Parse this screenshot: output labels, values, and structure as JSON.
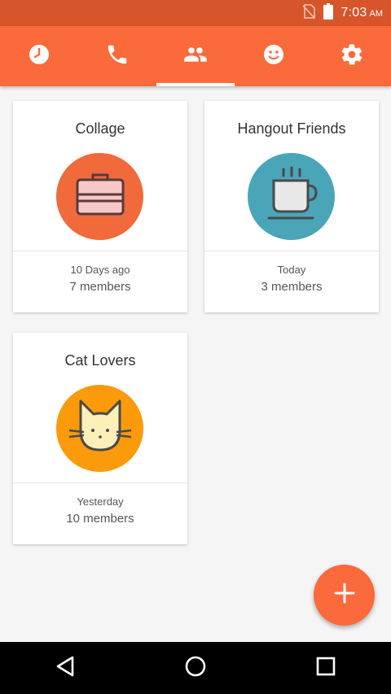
{
  "status_bar": {
    "time": "7:03",
    "ampm": "AM"
  },
  "tabs": [
    {
      "name": "recent",
      "icon": "clock-icon"
    },
    {
      "name": "calls",
      "icon": "phone-icon"
    },
    {
      "name": "groups",
      "icon": "people-icon",
      "active": true
    },
    {
      "name": "emoji",
      "icon": "smiley-icon"
    },
    {
      "name": "settings",
      "icon": "gear-icon"
    }
  ],
  "groups": [
    {
      "name": "Collage",
      "when": "10 Days ago",
      "members": "7 members",
      "icon": "briefcase-icon",
      "color": "#f06a3c"
    },
    {
      "name": "Hangout Friends",
      "when": "Today",
      "members": "3 members",
      "icon": "coffee-cup-icon",
      "color": "#4aa5b8"
    },
    {
      "name": "Cat Lovers",
      "when": "Yesterday",
      "members": "10 members",
      "icon": "cat-icon",
      "color": "#fb9a0a"
    }
  ],
  "colors": {
    "accent": "#fb6a3a",
    "status_bar": "#d6552b"
  }
}
